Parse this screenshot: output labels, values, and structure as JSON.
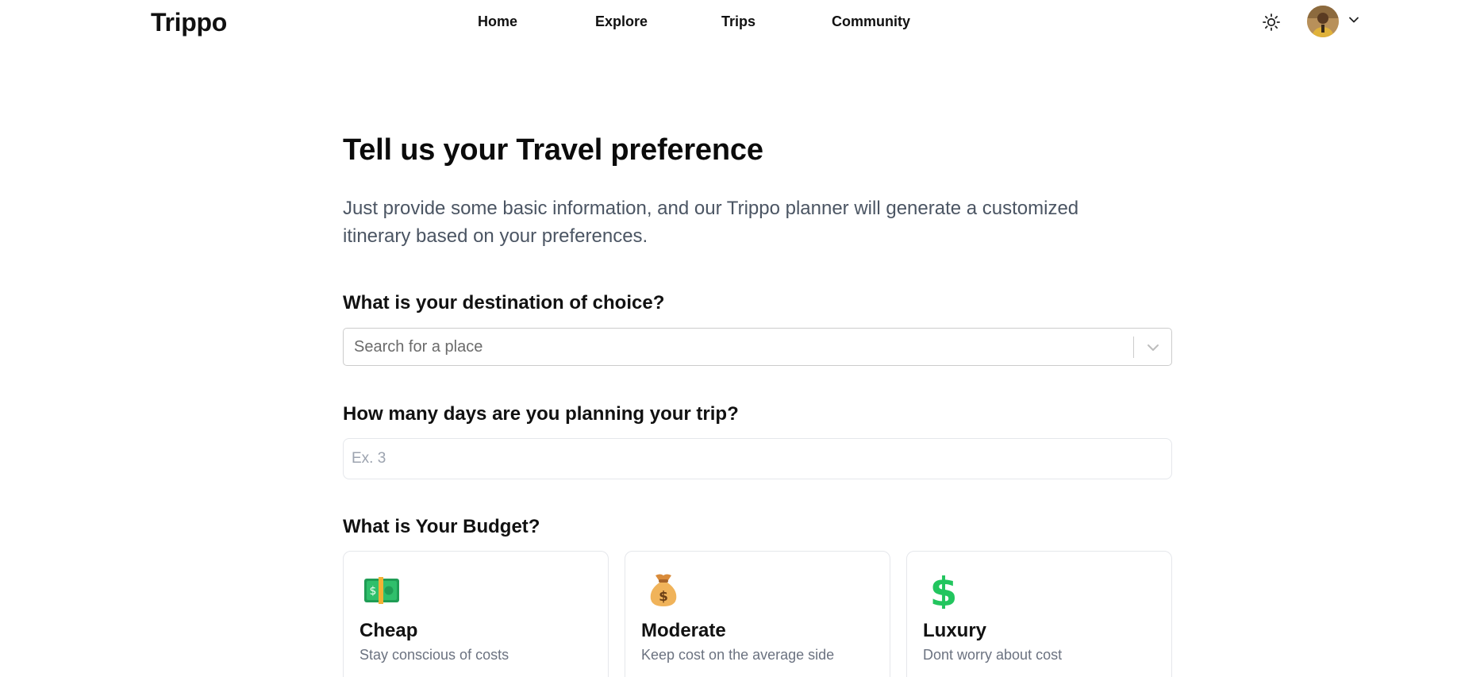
{
  "header": {
    "logo": "Trippo",
    "nav": [
      {
        "label": "Home"
      },
      {
        "label": "Explore"
      },
      {
        "label": "Trips"
      },
      {
        "label": "Community"
      }
    ],
    "theme_icon": "sun-icon",
    "avatar_icon": "user-avatar",
    "menu_icon": "chevron-down-icon"
  },
  "main": {
    "title": "Tell us your Travel preference",
    "subtitle": "Just provide some basic information, and our Trippo planner will generate a customized itinerary based on your preferences.",
    "destination": {
      "label": "What is your destination of choice?",
      "placeholder": "Search for a place",
      "value": ""
    },
    "days": {
      "label": "How many days are you planning your trip?",
      "placeholder": "Ex. 3",
      "value": ""
    },
    "budget": {
      "label": "What is Your Budget?",
      "options": [
        {
          "title": "Cheap",
          "description": "Stay conscious of costs",
          "icon": "banknote-icon"
        },
        {
          "title": "Moderate",
          "description": "Keep cost on the average side",
          "icon": "money-bag-icon"
        },
        {
          "title": "Luxury",
          "description": "Dont worry about cost",
          "icon": "dollar-sign-icon"
        }
      ]
    }
  },
  "colors": {
    "subtitle_text": "#4b5563",
    "muted_text": "#6b7280",
    "card_border": "#e5e7eb",
    "dollar_green": "#22c55e",
    "banknote_green": "#22a559"
  }
}
